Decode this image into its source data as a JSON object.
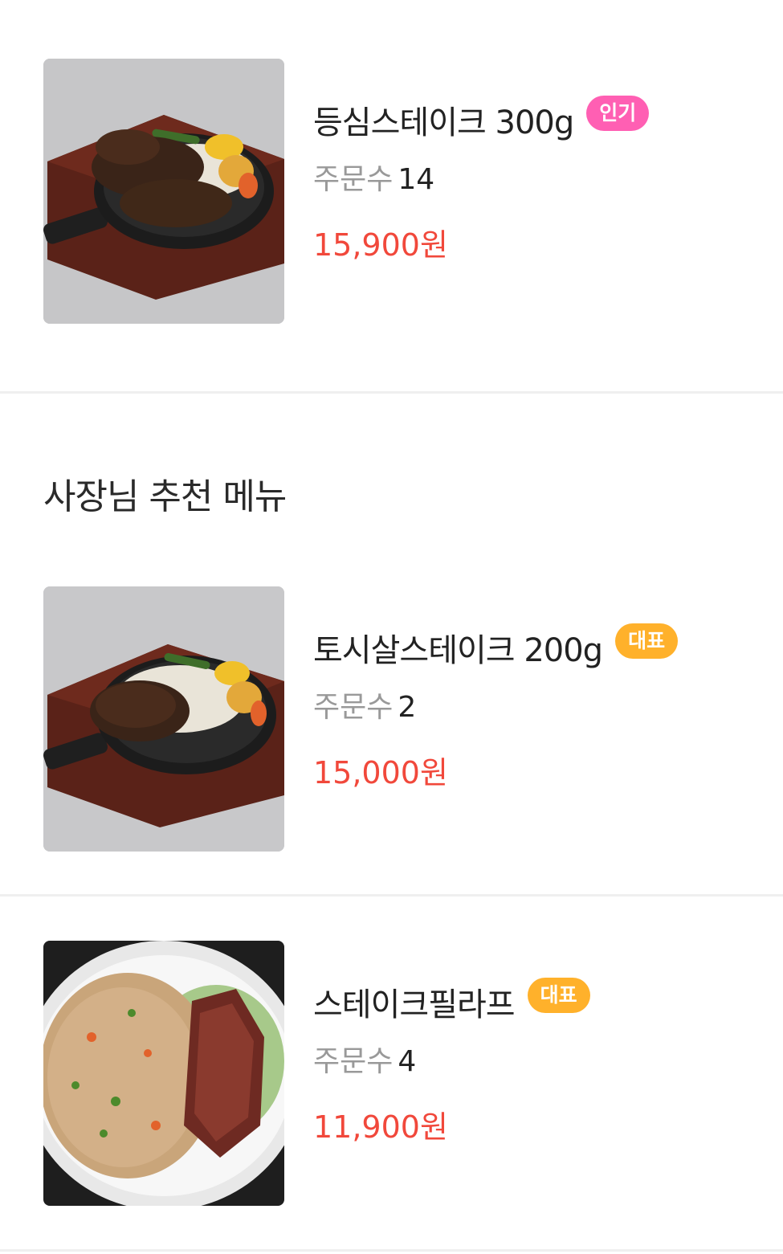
{
  "section": {
    "title": "사장님 추천 메뉴"
  },
  "items": [
    {
      "name": "등심스테이크 300g",
      "badge": "인기",
      "badge_color": "#ff5fb3",
      "orders_label": "주문수",
      "orders_count": "14",
      "price": "15,900원",
      "image": "sirloin-steak-on-sizzling-plate"
    },
    {
      "name": "토시살스테이크 200g",
      "badge": "대표",
      "badge_color": "#ffb12b",
      "orders_label": "주문수",
      "orders_count": "2",
      "price": "15,000원",
      "image": "hanger-steak-on-sizzling-plate"
    },
    {
      "name": "스테이크필라프",
      "badge": "대표",
      "badge_color": "#ffb12b",
      "orders_label": "주문수",
      "orders_count": "4",
      "price": "11,900원",
      "image": "steak-pilaf-plate"
    }
  ],
  "colors": {
    "price": "#f1483b",
    "divider": "#efefef",
    "muted_text": "#999999",
    "primary_text": "#222222"
  }
}
